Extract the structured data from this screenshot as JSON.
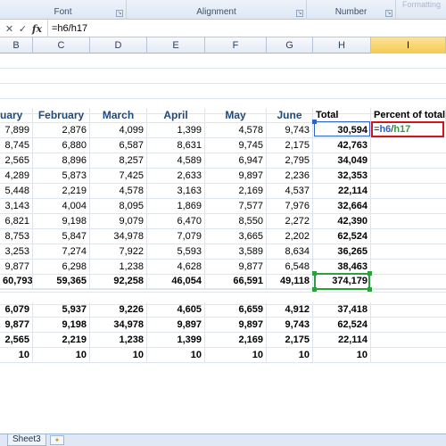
{
  "ribbon": {
    "font_label": "Font",
    "alignment_label": "Alignment",
    "number_label": "Number",
    "faded_label": "Formatting"
  },
  "formula_bar": {
    "cancel_glyph": "✕",
    "enter_glyph": "✓",
    "fx_label": "fx",
    "content": "=h6/h17"
  },
  "columns": [
    "B",
    "C",
    "D",
    "E",
    "F",
    "G",
    "H",
    "I"
  ],
  "active_column": "I",
  "header_row": {
    "B": "uary",
    "C": "February",
    "D": "March",
    "E": "April",
    "F": "May",
    "G": "June",
    "H": "Total",
    "I": "Percent of total"
  },
  "data_rows": [
    [
      "7,899",
      "2,876",
      "4,099",
      "1,399",
      "4,578",
      "9,743",
      "30,594"
    ],
    [
      "8,745",
      "6,880",
      "6,587",
      "8,631",
      "9,745",
      "2,175",
      "42,763"
    ],
    [
      "2,565",
      "8,896",
      "8,257",
      "4,589",
      "6,947",
      "2,795",
      "34,049"
    ],
    [
      "4,289",
      "5,873",
      "7,425",
      "2,633",
      "9,897",
      "2,236",
      "32,353"
    ],
    [
      "5,448",
      "2,219",
      "4,578",
      "3,163",
      "2,169",
      "4,537",
      "22,114"
    ],
    [
      "3,143",
      "4,004",
      "8,095",
      "1,869",
      "7,577",
      "7,976",
      "32,664"
    ],
    [
      "6,821",
      "9,198",
      "9,079",
      "6,470",
      "8,550",
      "2,272",
      "42,390"
    ],
    [
      "8,753",
      "5,847",
      "34,978",
      "7,079",
      "3,665",
      "2,202",
      "62,524"
    ],
    [
      "3,253",
      "7,274",
      "7,922",
      "5,593",
      "3,589",
      "8,634",
      "36,265"
    ],
    [
      "9,877",
      "6,298",
      "1,238",
      "4,628",
      "9,877",
      "6,548",
      "38,463"
    ]
  ],
  "totals_row": [
    "60,793",
    "59,365",
    "92,258",
    "46,054",
    "66,591",
    "49,118",
    "374,179"
  ],
  "stats_rows": [
    [
      "6,079",
      "5,937",
      "9,226",
      "4,605",
      "6,659",
      "4,912",
      "37,418"
    ],
    [
      "9,877",
      "9,198",
      "34,978",
      "9,897",
      "9,897",
      "9,743",
      "62,524"
    ],
    [
      "2,565",
      "2,219",
      "1,238",
      "1,399",
      "2,169",
      "2,175",
      "22,114"
    ],
    [
      "10",
      "10",
      "10",
      "10",
      "10",
      "10",
      "10"
    ]
  ],
  "edit_cell": {
    "eq": "=",
    "ref1": "h6",
    "slash": "/",
    "ref2": "h17"
  },
  "sheet_tab": "Sheet3",
  "colors": {
    "header_blue": "#1f497d",
    "ref_blue": "#2e64c7",
    "ref_green": "#2f9e3f",
    "edit_border_red": "#d0161b"
  }
}
